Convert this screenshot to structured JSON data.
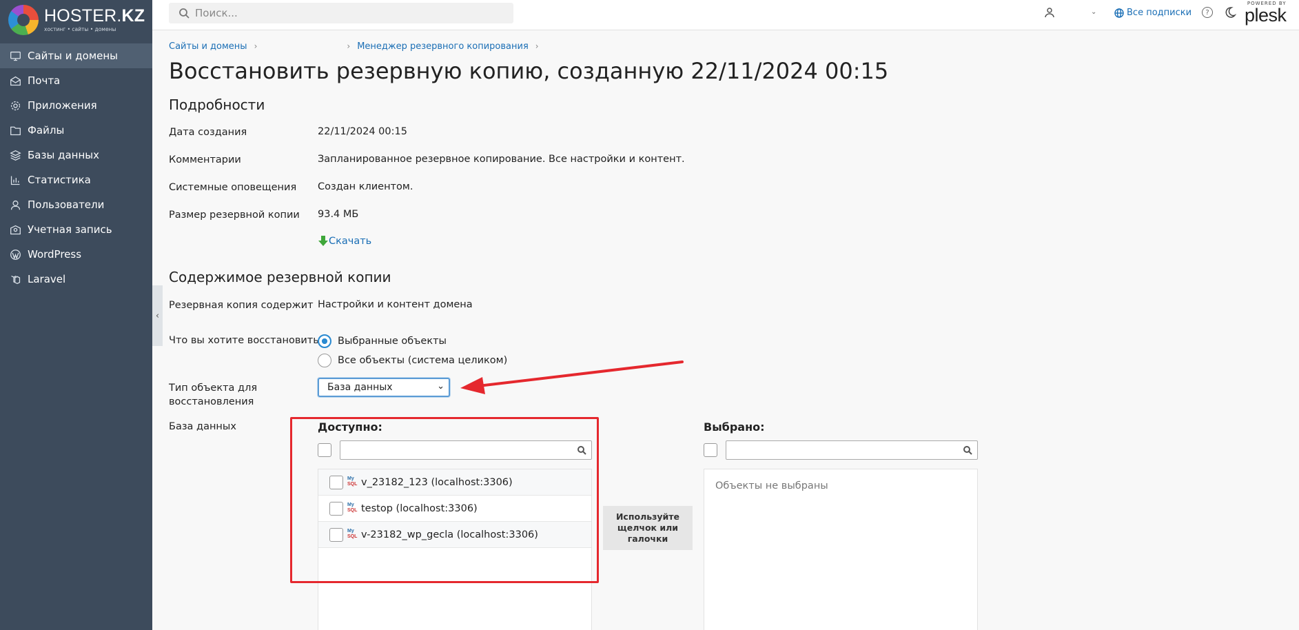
{
  "sidebar": {
    "logo_title": "HOSTER.",
    "logo_title_bold": "KZ",
    "logo_subtitle": "хостинг • сайты • домены",
    "items": [
      {
        "label": "Сайты и домены",
        "icon": "monitor-icon",
        "active": true
      },
      {
        "label": "Почта",
        "icon": "mail-icon"
      },
      {
        "label": "Приложения",
        "icon": "gear-icon"
      },
      {
        "label": "Файлы",
        "icon": "folder-icon"
      },
      {
        "label": "Базы данных",
        "icon": "database-layers-icon"
      },
      {
        "label": "Статистика",
        "icon": "bar-chart-icon"
      },
      {
        "label": "Пользователи",
        "icon": "user-icon"
      },
      {
        "label": "Учетная запись",
        "icon": "account-icon"
      },
      {
        "label": "WordPress",
        "icon": "wordpress-icon"
      },
      {
        "label": "Laravel",
        "icon": "laravel-icon"
      }
    ]
  },
  "topbar": {
    "search_placeholder": "Поиск...",
    "subscriptions_label": "Все подписки",
    "help_glyph": "?",
    "powered_by": "POWERED BY",
    "brand": "plesk"
  },
  "breadcrumb": {
    "item1": "Сайты и домены",
    "item3": "Менеджер резервного копирования"
  },
  "page": {
    "title": "Восстановить резервную копию, созданную 22/11/2024 00:15"
  },
  "details": {
    "heading": "Подробности",
    "created_label": "Дата создания",
    "created_value": "22/11/2024 00:15",
    "comments_label": "Комментарии",
    "comments_value": "Запланированное резервное копирование. Все настройки и контент.",
    "notifications_label": "Системные оповещения",
    "notifications_value": "Создан клиентом.",
    "size_label": "Размер резервной копии",
    "size_value": "93.4 МБ",
    "download_label": "Скачать"
  },
  "contents": {
    "heading": "Содержимое резервной копии",
    "contains_label": "Резервная копия содержит",
    "contains_value": "Настройки и контент домена",
    "restore_question": "Что вы хотите восстановить?",
    "option_selected": "Выбранные объекты",
    "option_all": "Все объекты (система целиком)",
    "type_label_line1": "Тип объекта для",
    "type_label_line2": "восстановления",
    "type_value": "База данных",
    "db_label": "База данных"
  },
  "available": {
    "heading": "Доступно:",
    "items": [
      "v_23182_123 (localhost:3306)",
      "testop (localhost:3306)",
      "v-23182_wp_gecla (localhost:3306)"
    ]
  },
  "selected": {
    "heading": "Выбрано:",
    "empty_text": "Объекты не выбраны"
  },
  "hint": {
    "line1": "Используйте",
    "line2": "щелчок или",
    "line3": "галочки"
  },
  "colors": {
    "sidebar_bg": "#3d4b5c",
    "link": "#1a6eb5",
    "annotation_red": "#e5282e",
    "radio_blue": "#2b8ad1"
  }
}
